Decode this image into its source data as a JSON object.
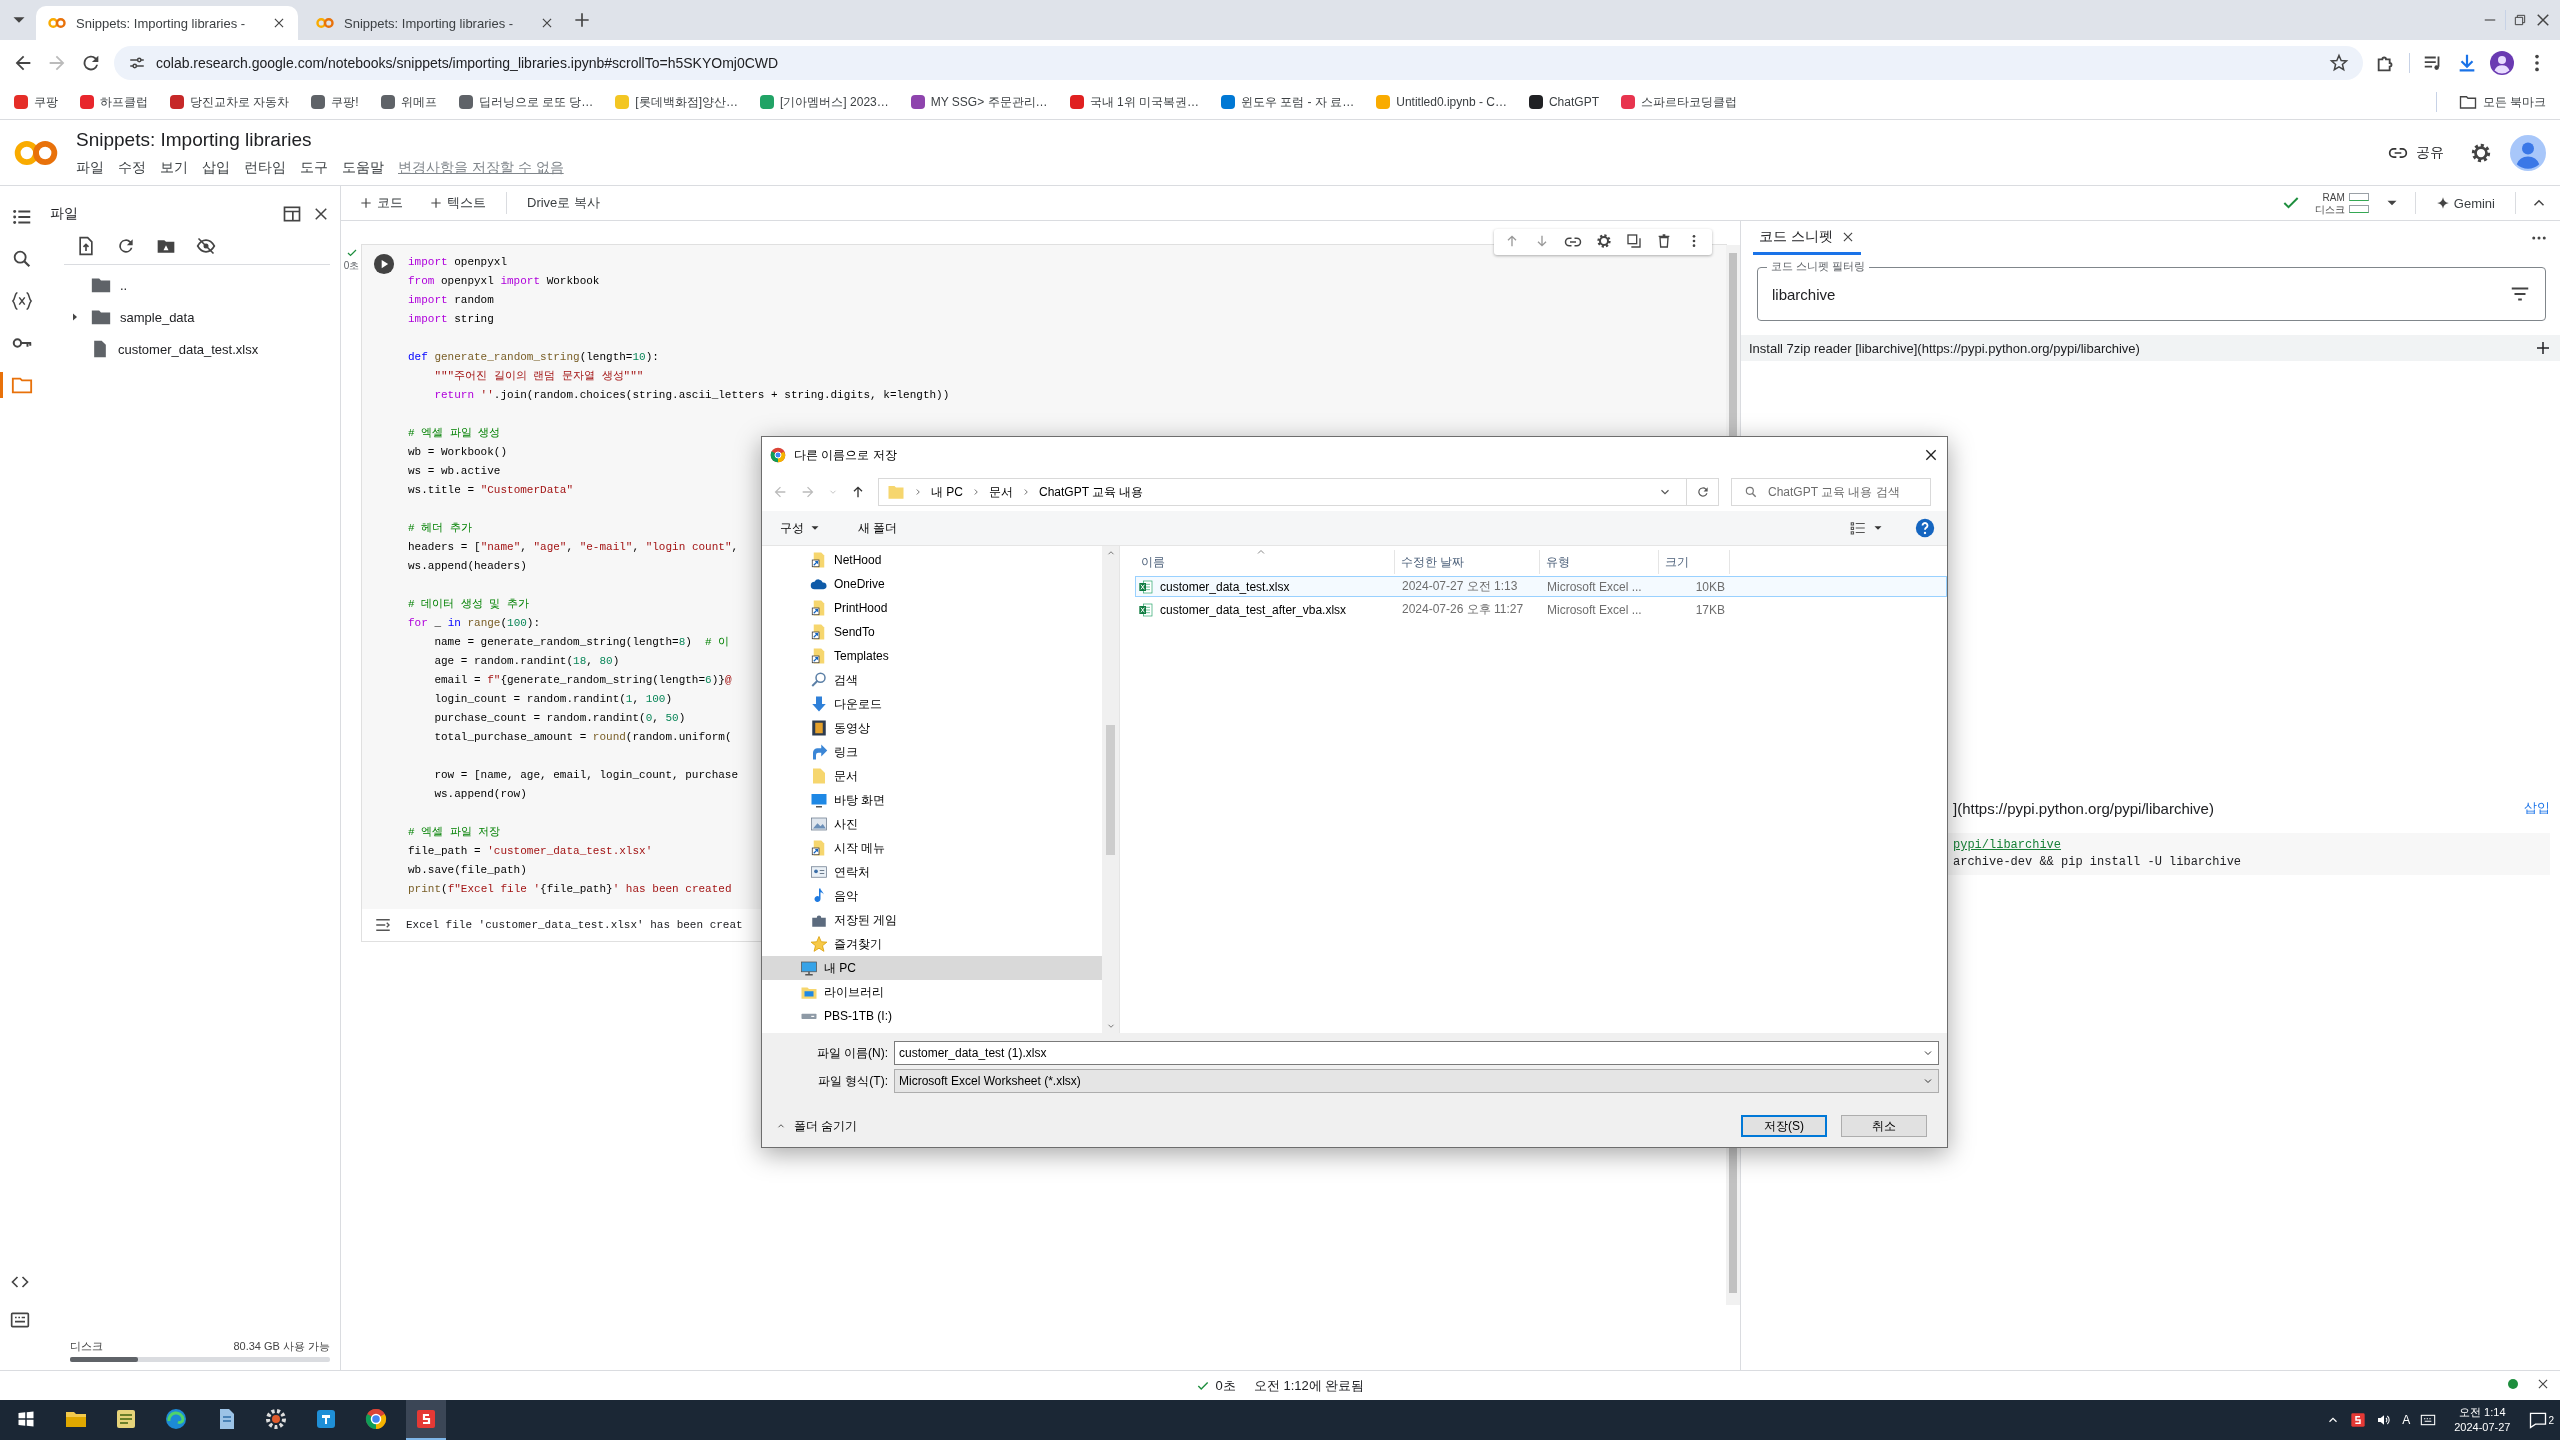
{
  "browser": {
    "tabs": [
      {
        "title": "Snippets: Importing libraries -",
        "selected": true
      },
      {
        "title": "Snippets: Importing libraries -",
        "selected": false
      }
    ],
    "url": "colab.research.google.com/notebooks/snippets/importing_libraries.ipynb#scrollTo=h5SKYOmj0CWD",
    "bookmarks": [
      {
        "label": "쿠팡",
        "color": "#e52d27"
      },
      {
        "label": "하프클럽",
        "color": "#e8262c"
      },
      {
        "label": "당진교차로 자동차",
        "color": "#c62828"
      },
      {
        "label": "쿠팡!",
        "color": "#5f6368"
      },
      {
        "label": "위메프",
        "color": "#5f6368"
      },
      {
        "label": "딥러닝으로 로또 당…",
        "color": "#5f6368"
      },
      {
        "label": "[롯데백화점]양산…",
        "color": "#f3c623"
      },
      {
        "label": "[기아멤버스] 2023…",
        "color": "#21a366"
      },
      {
        "label": "MY SSG> 주문관리…",
        "color": "#8e44ad"
      },
      {
        "label": "국내 1위 미국복권…",
        "color": "#e02020"
      },
      {
        "label": "윈도우 포럼 - 자 료…",
        "color": "#0078d4"
      },
      {
        "label": "Untitled0.ipynb - C…",
        "color": "#f9ab00"
      },
      {
        "label": "ChatGPT",
        "color": "#202124"
      },
      {
        "label": "스파르타코딩클럽",
        "color": "#e8344e"
      }
    ],
    "all_bookmarks": "모든 북마크"
  },
  "colab": {
    "title": "Snippets: Importing libraries",
    "menu": [
      "파일",
      "수정",
      "보기",
      "삽입",
      "런타임",
      "도구",
      "도움말"
    ],
    "save_notice": "변경사항을 저장할 수 없음",
    "share": "공유"
  },
  "toolbar": {
    "add_code": "코드",
    "add_text": "텍스트",
    "copy_to_drive": "Drive로 복사",
    "ram": "RAM",
    "disk": "디스크",
    "gemini": "Gemini"
  },
  "rail": [
    {
      "kind": "toc",
      "selected": false
    },
    {
      "kind": "search",
      "selected": false
    },
    {
      "kind": "variables",
      "selected": false
    },
    {
      "kind": "secrets",
      "selected": false
    },
    {
      "kind": "files",
      "selected": true
    }
  ],
  "files_panel": {
    "title": "파일",
    "tree": [
      {
        "name": "..",
        "kind": "parent"
      },
      {
        "name": "sample_data",
        "kind": "folder",
        "expanded": false
      },
      {
        "name": "customer_data_test.xlsx",
        "kind": "file"
      }
    ],
    "disk": {
      "label": "디스크",
      "free": "80.34 GB 사용 가능",
      "level": 0.26
    }
  },
  "cell": {
    "status": "0초",
    "lines": [
      {
        "kind": "code",
        "tokens": [
          {
            "kind": "kw",
            "text": "import"
          },
          {
            "kind": "plain",
            "text": " openpyxl"
          }
        ]
      },
      {
        "kind": "code",
        "tokens": [
          {
            "kind": "kw",
            "text": "from"
          },
          {
            "kind": "plain",
            "text": " openpyxl "
          },
          {
            "kind": "kw",
            "text": "import"
          },
          {
            "kind": "plain",
            "text": " Workbook"
          }
        ]
      },
      {
        "kind": "code",
        "tokens": [
          {
            "kind": "kw",
            "text": "import"
          },
          {
            "kind": "plain",
            "text": " random"
          }
        ]
      },
      {
        "kind": "code",
        "tokens": [
          {
            "kind": "kw",
            "text": "import"
          },
          {
            "kind": "plain",
            "text": " string"
          }
        ]
      },
      {
        "kind": "blank"
      },
      {
        "kind": "code",
        "tokens": [
          {
            "kind": "def",
            "text": "def"
          },
          {
            "kind": "fn",
            "text": " generate_random_string"
          },
          {
            "kind": "plain",
            "text": "(length="
          },
          {
            "kind": "num",
            "text": "10"
          },
          {
            "kind": "plain",
            "text": "):"
          }
        ]
      },
      {
        "kind": "code",
        "tokens": [
          {
            "kind": "str",
            "text": "    \"\"\"주어진 길이의 랜덤 문자열 생성\"\"\""
          }
        ]
      },
      {
        "kind": "code",
        "tokens": [
          {
            "kind": "kw",
            "text": "    return"
          },
          {
            "kind": "str",
            "text": " ''"
          },
          {
            "kind": "plain",
            "text": ".join(random.choices(string.ascii_letters + string.digits, k=length))"
          }
        ]
      },
      {
        "kind": "blank"
      },
      {
        "kind": "code",
        "tokens": [
          {
            "kind": "com",
            "text": "# 엑셀 파일 생성"
          }
        ]
      },
      {
        "kind": "code",
        "tokens": [
          {
            "kind": "plain",
            "text": "wb = Workbook()"
          }
        ]
      },
      {
        "kind": "code",
        "tokens": [
          {
            "kind": "plain",
            "text": "ws = wb.active"
          }
        ]
      },
      {
        "kind": "code",
        "tokens": [
          {
            "kind": "plain",
            "text": "ws.title = "
          },
          {
            "kind": "str",
            "text": "\"CustomerData\""
          }
        ]
      },
      {
        "kind": "blank"
      },
      {
        "kind": "code",
        "tokens": [
          {
            "kind": "com",
            "text": "# 헤더 추가"
          }
        ]
      },
      {
        "kind": "code",
        "tokens": [
          {
            "kind": "plain",
            "text": "headers = ["
          },
          {
            "kind": "str",
            "text": "\"name\""
          },
          {
            "kind": "plain",
            "text": ", "
          },
          {
            "kind": "str",
            "text": "\"age\""
          },
          {
            "kind": "plain",
            "text": ", "
          },
          {
            "kind": "str",
            "text": "\"e-mail\""
          },
          {
            "kind": "plain",
            "text": ", "
          },
          {
            "kind": "str",
            "text": "\"login count\""
          },
          {
            "kind": "plain",
            "text": ","
          }
        ]
      },
      {
        "kind": "code",
        "tokens": [
          {
            "kind": "plain",
            "text": "ws.append(headers)"
          }
        ]
      },
      {
        "kind": "blank"
      },
      {
        "kind": "code",
        "tokens": [
          {
            "kind": "com",
            "text": "# 데이터 생성 및 추가"
          }
        ]
      },
      {
        "kind": "code",
        "tokens": [
          {
            "kind": "kw",
            "text": "for"
          },
          {
            "kind": "plain",
            "text": " _ "
          },
          {
            "kind": "def",
            "text": "in"
          },
          {
            "kind": "fn",
            "text": " range"
          },
          {
            "kind": "plain",
            "text": "("
          },
          {
            "kind": "num",
            "text": "100"
          },
          {
            "kind": "plain",
            "text": "):"
          }
        ]
      },
      {
        "kind": "code",
        "tokens": [
          {
            "kind": "plain",
            "text": "    name = generate_random_string(length="
          },
          {
            "kind": "num",
            "text": "8"
          },
          {
            "kind": "plain",
            "text": ")  "
          },
          {
            "kind": "com",
            "text": "# 이"
          }
        ]
      },
      {
        "kind": "code",
        "tokens": [
          {
            "kind": "plain",
            "text": "    age = random.randint("
          },
          {
            "kind": "num",
            "text": "18"
          },
          {
            "kind": "plain",
            "text": ", "
          },
          {
            "kind": "num",
            "text": "80"
          },
          {
            "kind": "plain",
            "text": ")"
          }
        ]
      },
      {
        "kind": "code",
        "tokens": [
          {
            "kind": "plain",
            "text": "    email = "
          },
          {
            "kind": "str",
            "text": "f\""
          },
          {
            "kind": "plain",
            "text": "{generate_random_string(length="
          },
          {
            "kind": "num",
            "text": "6"
          },
          {
            "kind": "plain",
            "text": ")}"
          },
          {
            "kind": "str",
            "text": "@"
          }
        ]
      },
      {
        "kind": "code",
        "tokens": [
          {
            "kind": "plain",
            "text": "    login_count = random.randint("
          },
          {
            "kind": "num",
            "text": "1"
          },
          {
            "kind": "plain",
            "text": ", "
          },
          {
            "kind": "num",
            "text": "100"
          },
          {
            "kind": "plain",
            "text": ")"
          }
        ]
      },
      {
        "kind": "code",
        "tokens": [
          {
            "kind": "plain",
            "text": "    purchase_count = random.randint("
          },
          {
            "kind": "num",
            "text": "0"
          },
          {
            "kind": "plain",
            "text": ", "
          },
          {
            "kind": "num",
            "text": "50"
          },
          {
            "kind": "plain",
            "text": ")"
          }
        ]
      },
      {
        "kind": "code",
        "tokens": [
          {
            "kind": "plain",
            "text": "    total_purchase_amount = "
          },
          {
            "kind": "fn",
            "text": "round"
          },
          {
            "kind": "plain",
            "text": "(random.uniform("
          }
        ]
      },
      {
        "kind": "blank"
      },
      {
        "kind": "code",
        "tokens": [
          {
            "kind": "plain",
            "text": "    row = [name, age, email, login_count, purchase"
          }
        ]
      },
      {
        "kind": "code",
        "tokens": [
          {
            "kind": "plain",
            "text": "    ws.append(row)"
          }
        ]
      },
      {
        "kind": "blank"
      },
      {
        "kind": "code",
        "tokens": [
          {
            "kind": "com",
            "text": "# 엑셀 파일 저장"
          }
        ]
      },
      {
        "kind": "code",
        "tokens": [
          {
            "kind": "plain",
            "text": "file_path = "
          },
          {
            "kind": "str",
            "text": "'customer_data_test.xlsx'"
          }
        ]
      },
      {
        "kind": "code",
        "tokens": [
          {
            "kind": "plain",
            "text": "wb.save(file_path)"
          }
        ]
      },
      {
        "kind": "code",
        "tokens": [
          {
            "kind": "fn",
            "text": "print"
          },
          {
            "kind": "plain",
            "text": "("
          },
          {
            "kind": "str",
            "text": "f\"Excel file '"
          },
          {
            "kind": "plain",
            "text": "{file_path}"
          },
          {
            "kind": "str",
            "text": "' has been created"
          }
        ]
      }
    ],
    "output": "Excel file 'customer_data_test.xlsx' has been creat"
  },
  "snippets_panel": {
    "tab": "코드 스니펫",
    "filter_label": "코드 스니펫 필터링",
    "filter_value": "libarchive",
    "result": "Install 7zip reader [libarchive](https://pypi.python.org/pypi/libarchive)",
    "detail_title": "](https://pypi.python.org/pypi/libarchive)",
    "insert": "삽입",
    "code_lines": [
      {
        "kind": "link",
        "text": "pypi/libarchive"
      },
      {
        "kind": "plain",
        "text": "archive-dev && pip install -U libarchive"
      }
    ]
  },
  "save_dialog": {
    "title": "다른 이름으로 저장",
    "path": [
      "내 PC",
      "문서",
      "ChatGPT 교육 내용"
    ],
    "search_placeholder": "ChatGPT 교육 내용 검색",
    "organize": "구성",
    "new_folder": "새 폴더",
    "tree": [
      {
        "children": [
          {
            "label": "NetHood",
            "kind": "shortcut",
            "selected": false
          },
          {
            "label": "OneDrive",
            "kind": "cloud",
            "selected": false
          },
          {
            "label": "PrintHood",
            "kind": "shortcut",
            "selected": false
          },
          {
            "label": "SendTo",
            "kind": "shortcut",
            "selected": false
          },
          {
            "label": "Templates",
            "kind": "shortcut",
            "selected": false
          },
          {
            "label": "검색",
            "kind": "search",
            "selected": false
          },
          {
            "label": "다운로드",
            "kind": "download",
            "selected": false
          },
          {
            "label": "동영상",
            "kind": "video",
            "selected": false
          },
          {
            "label": "링크",
            "kind": "link",
            "selected": false
          },
          {
            "label": "문서",
            "kind": "folder",
            "selected": false
          },
          {
            "label": "바탕 화면",
            "kind": "desktop",
            "selected": false
          },
          {
            "label": "사진",
            "kind": "picture",
            "selected": false
          },
          {
            "label": "시작 메뉴",
            "kind": "shortcut",
            "selected": false
          },
          {
            "label": "연락처",
            "kind": "contacts",
            "selected": false
          },
          {
            "label": "음악",
            "kind": "music",
            "selected": false
          },
          {
            "label": "저장된 게임",
            "kind": "game",
            "selected": false
          },
          {
            "label": "즐겨찾기",
            "kind": "star",
            "selected": false
          }
        ]
      },
      {
        "label": "내 PC",
        "kind": "pc",
        "selected": true
      },
      {
        "label": "라이브러리",
        "kind": "library",
        "selected": false
      },
      {
        "label": "PBS-1TB (I:)",
        "kind": "drive",
        "selected": false
      }
    ],
    "columns": [
      "이름",
      "수정한 날짜",
      "유형",
      "크기"
    ],
    "files": [
      {
        "name": "customer_data_test.xlsx",
        "modified": "2024-07-27 오전 1:13",
        "type": "Microsoft Excel ...",
        "size": "10KB",
        "selected": true
      },
      {
        "name": "customer_data_test_after_vba.xlsx",
        "modified": "2024-07-26 오후 11:27",
        "type": "Microsoft Excel ...",
        "size": "17KB",
        "selected": false
      }
    ],
    "filename_label": "파일 이름(N):",
    "filename": "customer_data_test (1).xlsx",
    "filetype_label": "파일 형식(T):",
    "filetype": "Microsoft Excel Worksheet (*.xlsx)",
    "hide_folders": "폴더 숨기기",
    "save": "저장(S)",
    "cancel": "취소"
  },
  "status_bar": {
    "elapsed": "0초",
    "completed": "오전 1:12에 완료됨"
  },
  "taskbar": {
    "apps": [
      {
        "kind": "folder",
        "selected": false
      },
      {
        "kind": "notepad",
        "selected": false
      },
      {
        "kind": "swirl",
        "selected": false
      },
      {
        "kind": "document",
        "selected": false
      },
      {
        "kind": "gear",
        "selected": false
      },
      {
        "kind": "tile",
        "selected": false
      },
      {
        "kind": "ring",
        "selected": false
      },
      {
        "kind": "redtile",
        "selected": true
      }
    ],
    "ime": "A",
    "time": "오전 1:14",
    "date": "2024-07-27",
    "notifications": "2"
  }
}
